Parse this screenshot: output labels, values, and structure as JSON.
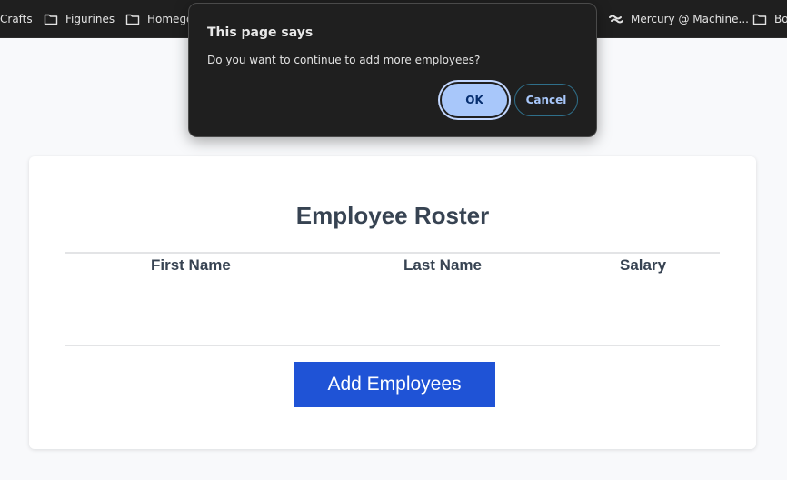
{
  "bookmarks": [
    {
      "label": "Crafts",
      "icon": "folder-icon"
    },
    {
      "label": "Figurines",
      "icon": "folder-icon"
    },
    {
      "label": "Homego",
      "icon": "folder-icon"
    },
    {
      "label": "Mercury @ Machine...",
      "icon": "mercury-icon"
    },
    {
      "label": "Bo",
      "icon": "folder-icon"
    }
  ],
  "dialog": {
    "title": "This page says",
    "message": "Do you want to continue to add more employees?",
    "ok_label": "OK",
    "cancel_label": "Cancel"
  },
  "roster": {
    "title": "Employee Roster",
    "columns": [
      "First Name",
      "Last Name",
      "Salary"
    ],
    "rows": [],
    "add_button_label": "Add Employees"
  },
  "colors": {
    "accent": "#1f53d6",
    "dialog_bg": "#1f1f1f",
    "ok_bg": "#a8c7fa",
    "heading_text": "#374352"
  }
}
